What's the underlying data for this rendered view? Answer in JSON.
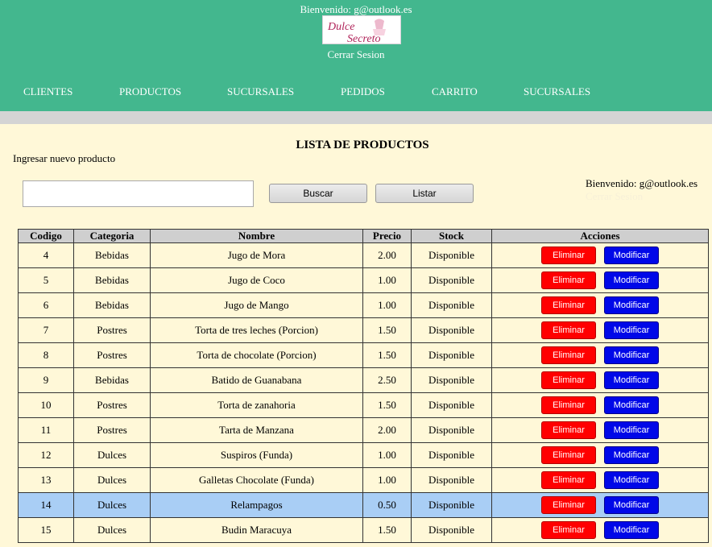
{
  "header": {
    "welcome": "Bienvenido: g@outlook.es",
    "logo_text": [
      "Dulce",
      "Secreto"
    ],
    "logout": "Cerrar Sesion",
    "bg_color": "#43b78e"
  },
  "nav": [
    {
      "label": "CLIENTES"
    },
    {
      "label": "PRODUCTOS"
    },
    {
      "label": "SUCURSALES"
    },
    {
      "label": "PEDIDOS"
    },
    {
      "label": "CARRITO"
    },
    {
      "label": "SUCURSALES"
    }
  ],
  "main": {
    "title": "LISTA DE PRODUCTOS",
    "new_product_link": "Ingresar nuevo producto",
    "search": {
      "value": "",
      "placeholder": ""
    },
    "search_button": "Buscar",
    "list_button": "Listar",
    "welcome": "Bienvenido: g@outlook.es",
    "logout": "Cerrar Sesion"
  },
  "table": {
    "columns": [
      "Codigo",
      "Categoria",
      "Nombre",
      "Precio",
      "Stock",
      "Acciones"
    ],
    "delete_label": "Eliminar",
    "modify_label": "Modificar",
    "highlight_color": "#a9cef5",
    "rows": [
      {
        "codigo": "4",
        "categoria": "Bebidas",
        "nombre": "Jugo de Mora",
        "precio": "2.00",
        "stock": "Disponible"
      },
      {
        "codigo": "5",
        "categoria": "Bebidas",
        "nombre": "Jugo de Coco",
        "precio": "1.00",
        "stock": "Disponible"
      },
      {
        "codigo": "6",
        "categoria": "Bebidas",
        "nombre": "Jugo de Mango",
        "precio": "1.00",
        "stock": "Disponible"
      },
      {
        "codigo": "7",
        "categoria": "Postres",
        "nombre": "Torta de tres leches (Porcion)",
        "precio": "1.50",
        "stock": "Disponible"
      },
      {
        "codigo": "8",
        "categoria": "Postres",
        "nombre": "Torta de chocolate (Porcion)",
        "precio": "1.50",
        "stock": "Disponible"
      },
      {
        "codigo": "9",
        "categoria": "Bebidas",
        "nombre": "Batido de Guanabana",
        "precio": "2.50",
        "stock": "Disponible"
      },
      {
        "codigo": "10",
        "categoria": "Postres",
        "nombre": "Torta de zanahoria",
        "precio": "1.50",
        "stock": "Disponible"
      },
      {
        "codigo": "11",
        "categoria": "Postres",
        "nombre": "Tarta de Manzana",
        "precio": "2.00",
        "stock": "Disponible"
      },
      {
        "codigo": "12",
        "categoria": "Dulces",
        "nombre": "Suspiros (Funda)",
        "precio": "1.00",
        "stock": "Disponible"
      },
      {
        "codigo": "13",
        "categoria": "Dulces",
        "nombre": "Galletas Chocolate (Funda)",
        "precio": "1.00",
        "stock": "Disponible"
      },
      {
        "codigo": "14",
        "categoria": "Dulces",
        "nombre": "Relampagos",
        "precio": "0.50",
        "stock": "Disponible",
        "highlighted": true
      },
      {
        "codigo": "15",
        "categoria": "Dulces",
        "nombre": "Budin Maracuya",
        "precio": "1.50",
        "stock": "Disponible"
      }
    ]
  }
}
